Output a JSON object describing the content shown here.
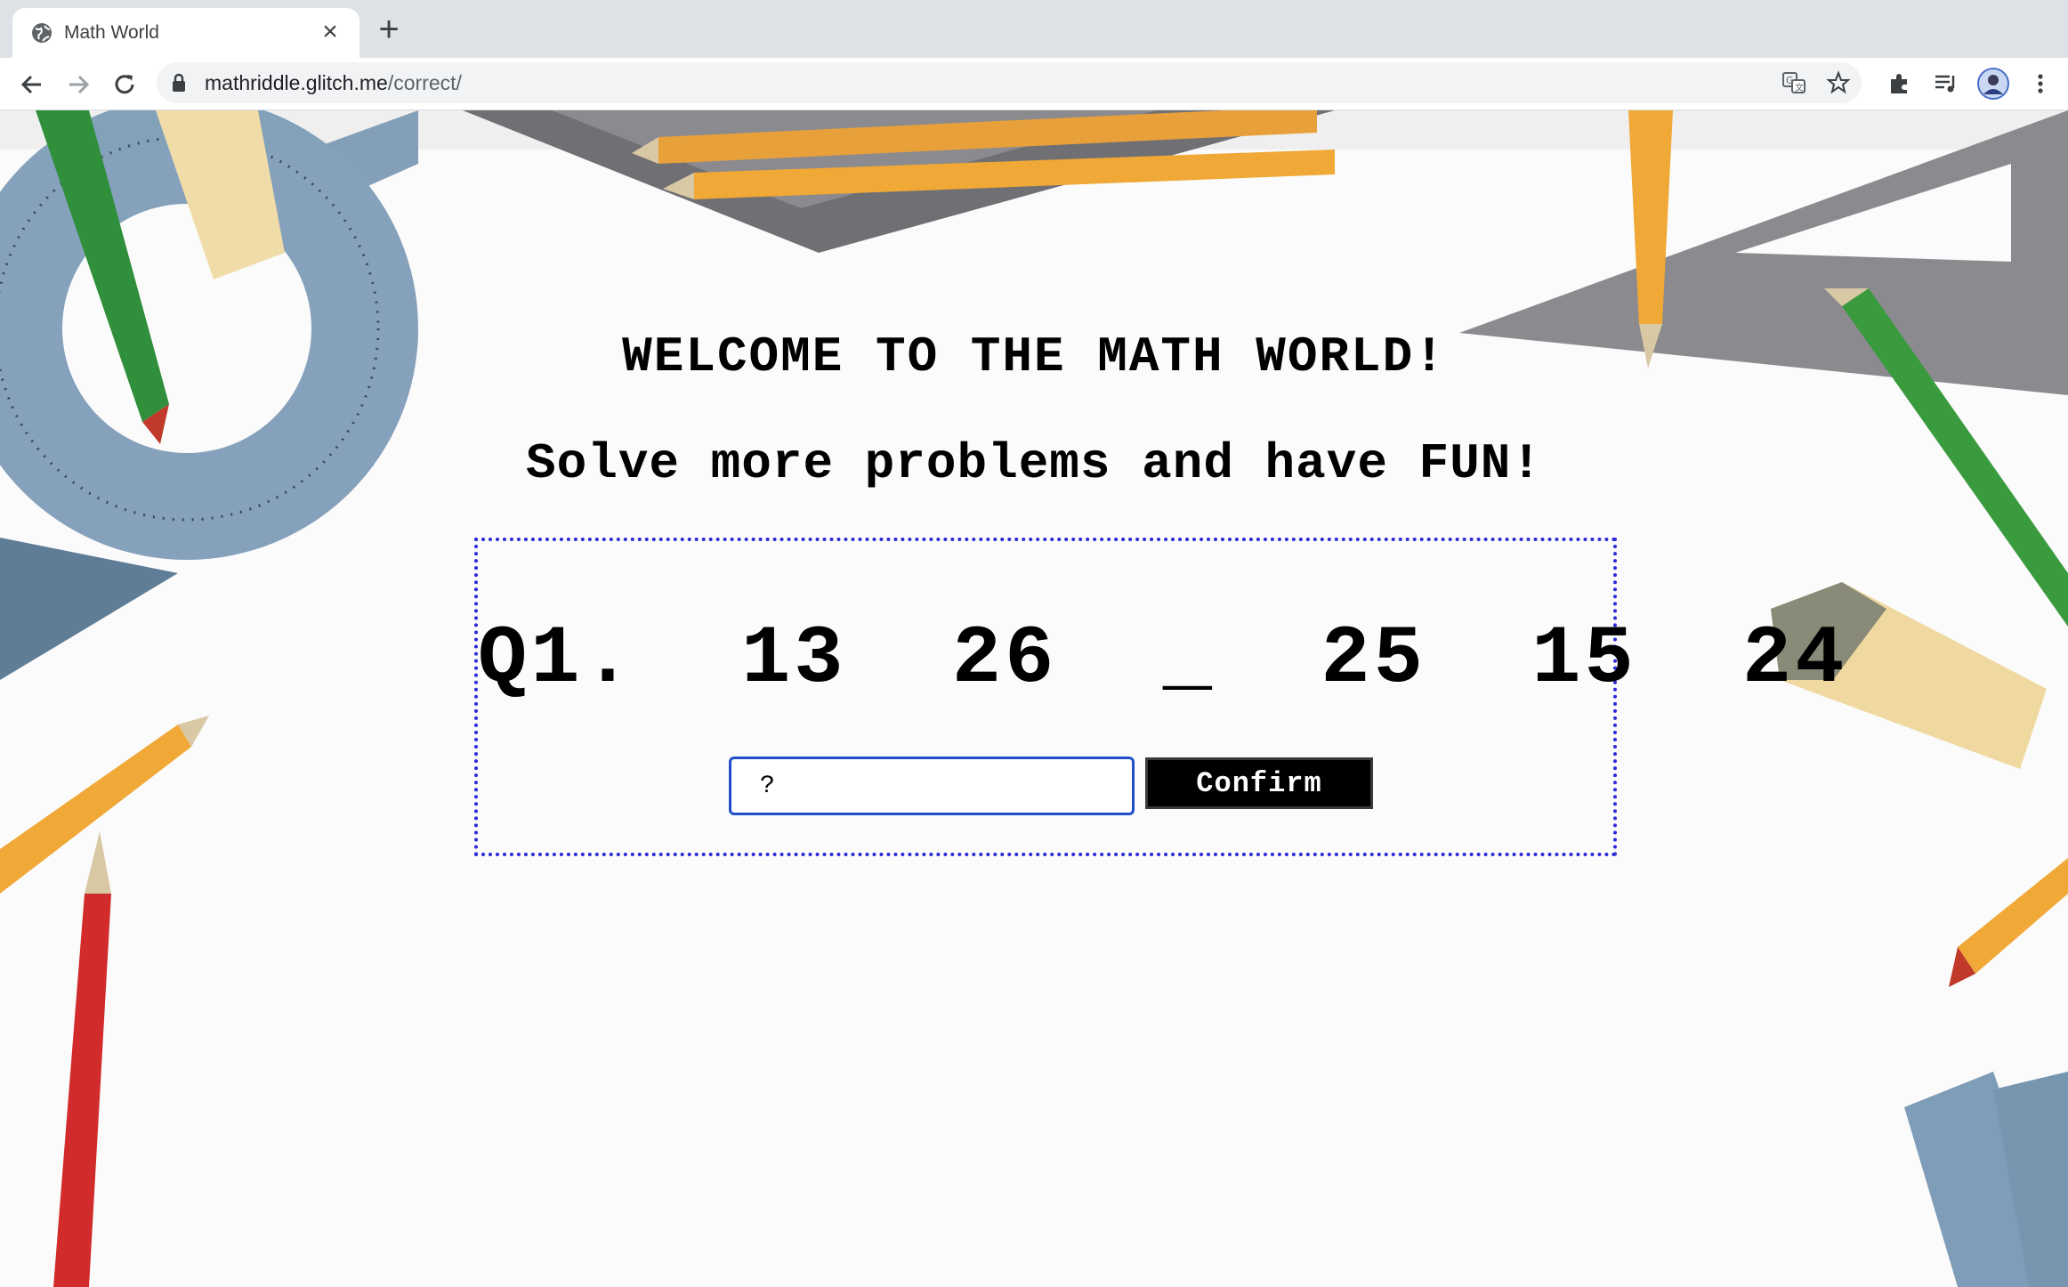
{
  "browser": {
    "tab_title": "Math World",
    "url_host": "mathriddle.glitch.me",
    "url_path": "/correct/",
    "icons": [
      "globe-icon",
      "close-icon",
      "plus-icon",
      "back-arrow-icon",
      "forward-arrow-icon",
      "reload-icon",
      "lock-icon",
      "translate-icon",
      "star-icon",
      "extensions-icon",
      "media-control-icon",
      "profile-avatar-icon",
      "kebab-menu-icon"
    ]
  },
  "page": {
    "welcome": "WELCOME TO THE MATH WORLD!",
    "subtitle": "Solve more problems and have FUN!",
    "question_label": "Q1.",
    "sequence": "13  26  _  25  15  24",
    "answer_value": "?",
    "confirm_label": "Confirm"
  },
  "colors": {
    "box_border": "#2a2ad8",
    "input_border": "#1f4fc8",
    "button_bg": "#000000",
    "button_text": "#ffffff"
  }
}
